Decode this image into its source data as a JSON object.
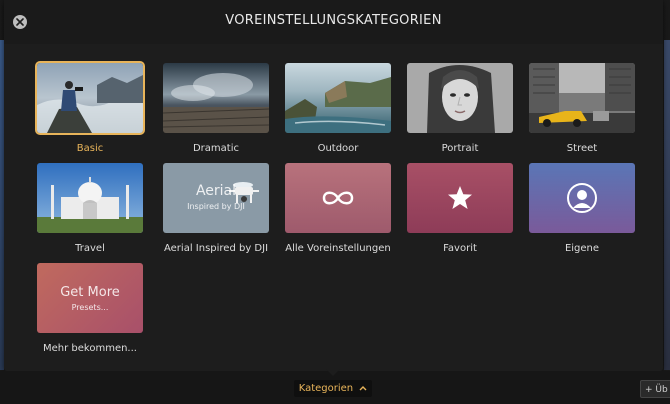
{
  "dialog": {
    "title": "VOREINSTELLUNGSKATEGORIEN"
  },
  "categories": [
    {
      "label": "Basic",
      "selected": true
    },
    {
      "label": "Dramatic",
      "selected": false
    },
    {
      "label": "Outdoor",
      "selected": false
    },
    {
      "label": "Portrait",
      "selected": false
    },
    {
      "label": "Street",
      "selected": false
    },
    {
      "label": "Travel",
      "selected": false
    },
    {
      "label": "Aerial Inspired by DJI",
      "selected": false,
      "overlay_title": "Aerial",
      "overlay_sub": "Inspired by DJI"
    },
    {
      "label": "Alle Voreinstellungen",
      "selected": false,
      "icon": "infinity-icon"
    },
    {
      "label": "Favorit",
      "selected": false,
      "icon": "star-icon"
    },
    {
      "label": "Eigene",
      "selected": false,
      "icon": "user-icon"
    },
    {
      "label": "Mehr bekommen...",
      "selected": false,
      "overlay_title": "Get More",
      "overlay_sub": "Presets..."
    }
  ],
  "bottombar": {
    "categories_label": "Kategorien",
    "add_label": "+ Üb"
  },
  "colors": {
    "accent": "#e8b45a",
    "panel": "#1d1d1d"
  }
}
